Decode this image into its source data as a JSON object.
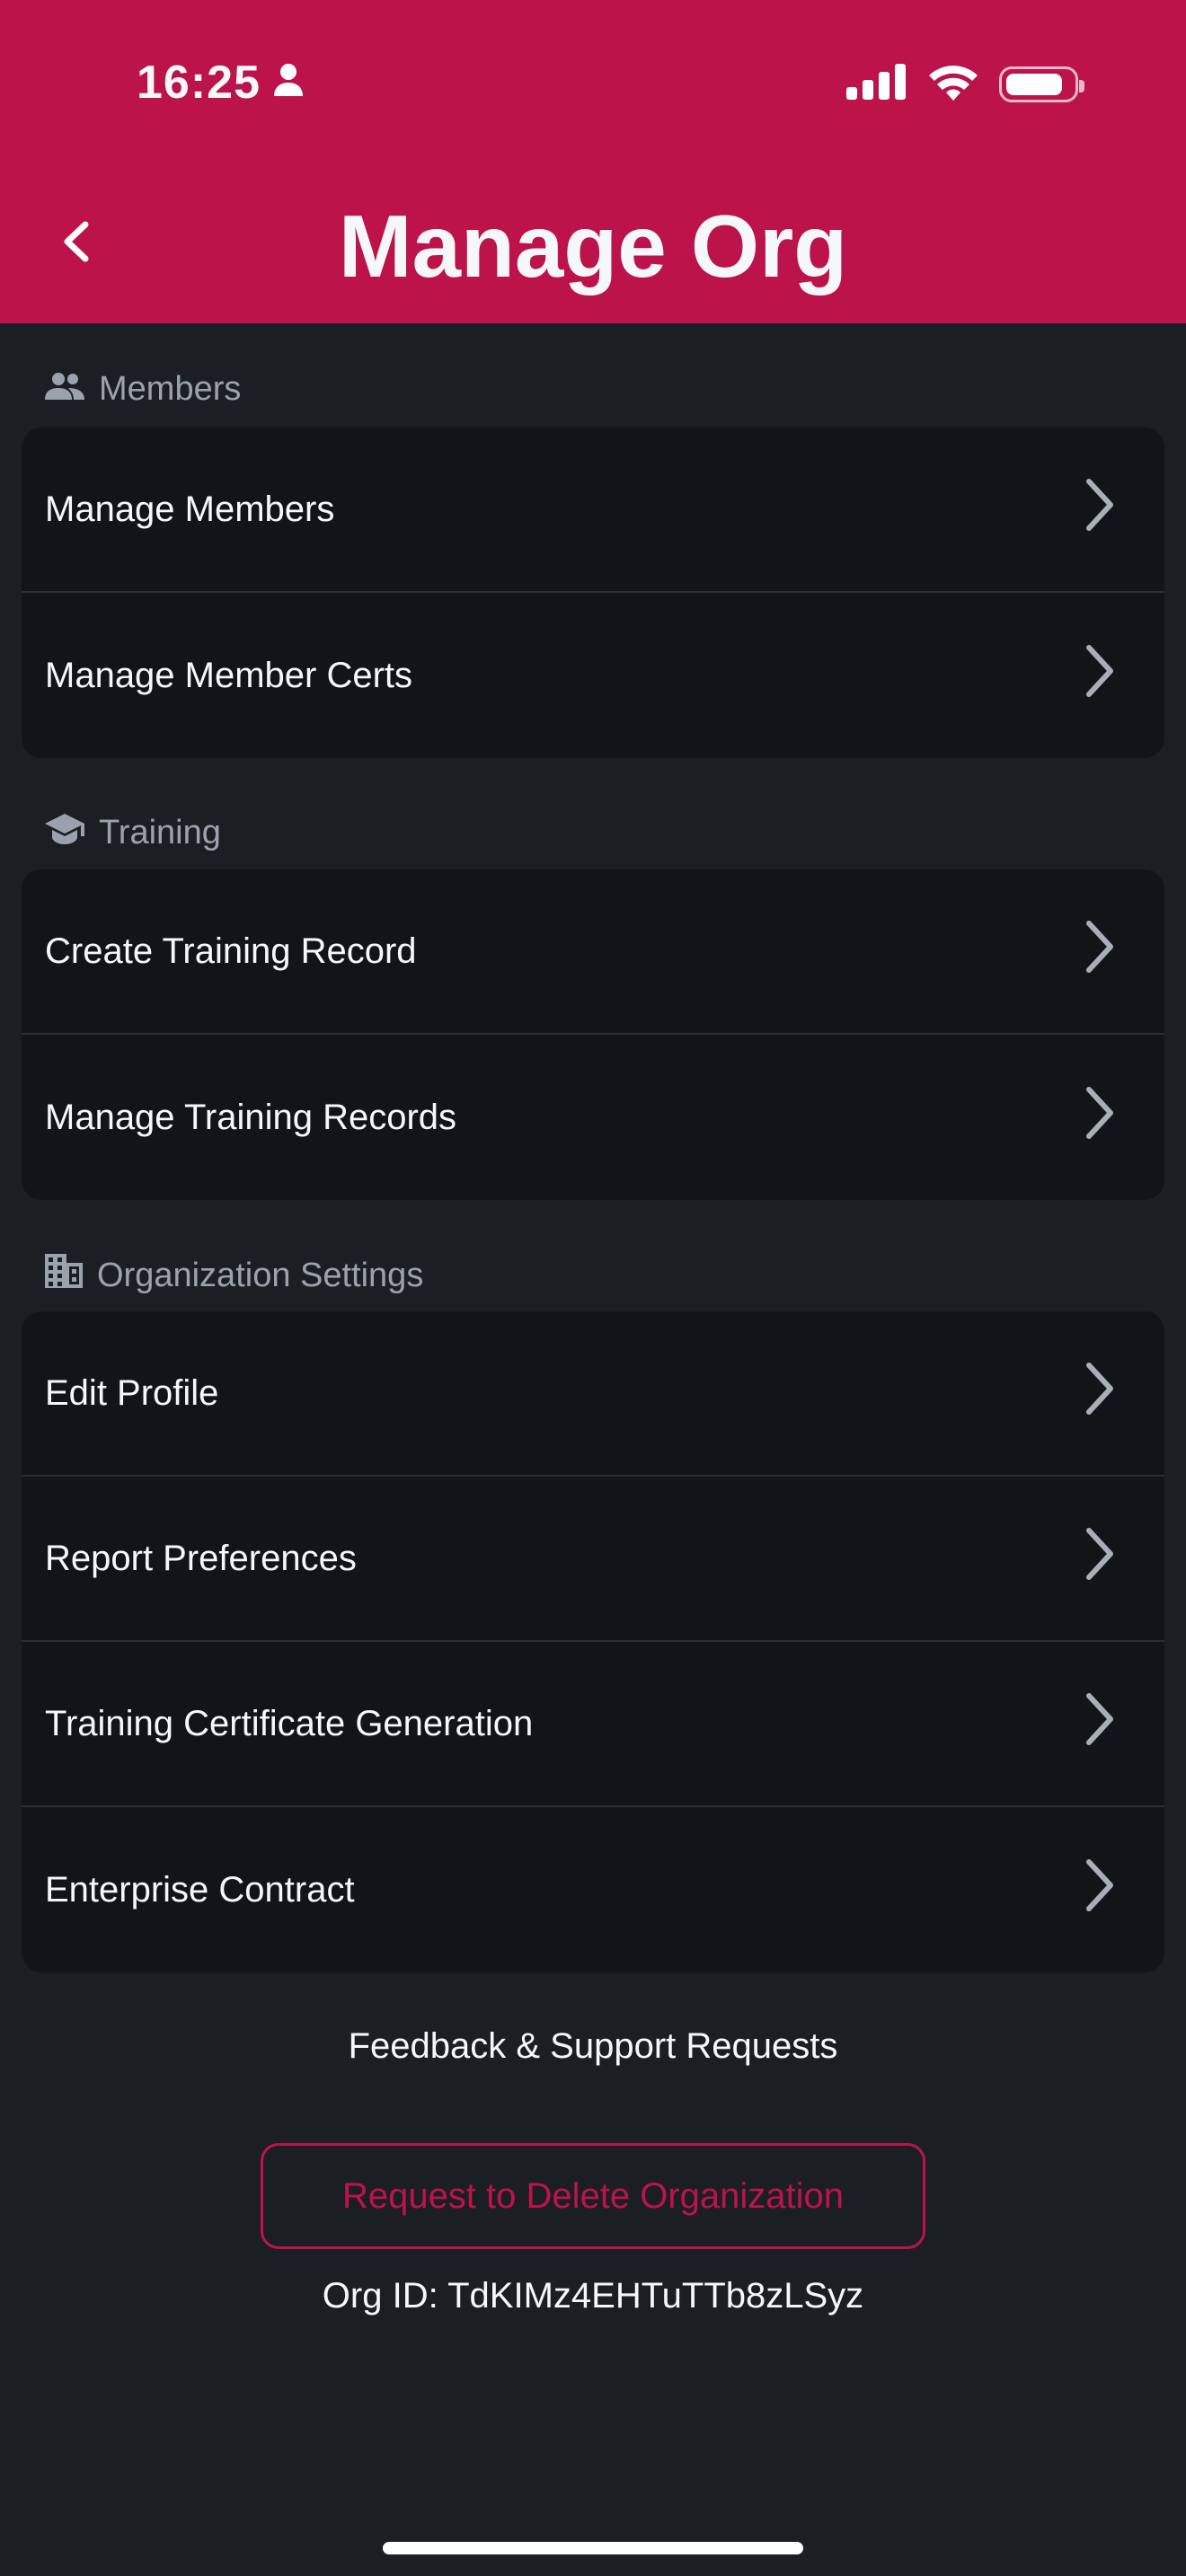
{
  "status_bar": {
    "time": "16:25",
    "icons": [
      "person-icon",
      "signal-icon",
      "wifi-icon",
      "battery-icon"
    ]
  },
  "header": {
    "title": "Manage Org",
    "back_icon": "chevron-left-icon"
  },
  "sections": [
    {
      "label": "Members",
      "icon": "people-icon",
      "items": [
        "Manage Members",
        "Manage Member Certs"
      ]
    },
    {
      "label": "Training",
      "icon": "graduation-cap-icon",
      "items": [
        "Create Training Record",
        "Manage Training Records"
      ]
    },
    {
      "label": "Organization Settings",
      "icon": "building-icon",
      "items": [
        "Edit Profile",
        "Report Preferences",
        "Training Certificate Generation",
        "Enterprise Contract"
      ]
    }
  ],
  "footer": {
    "feedback_link": "Feedback & Support Requests",
    "delete_button": "Request to Delete Organization",
    "org_id": "Org ID: TdKIMz4EHTuTTb8zLSyz"
  },
  "colors": {
    "accent": "#BC134A",
    "background": "#1B1F23",
    "card": "#121518",
    "muted_text": "#9AA3AD"
  }
}
